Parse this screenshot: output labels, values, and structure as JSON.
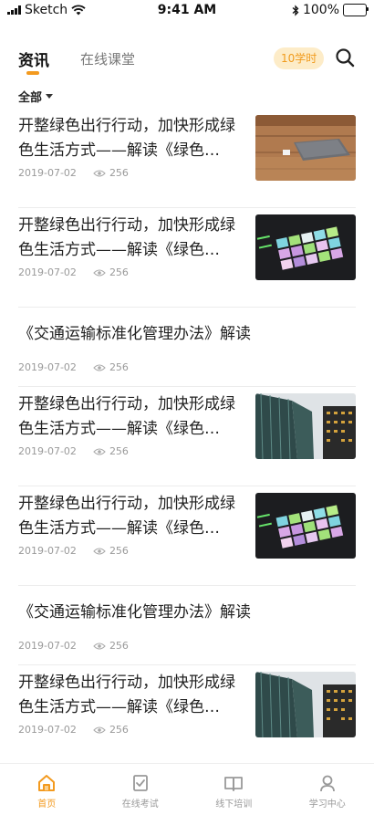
{
  "status_bar": {
    "carrier": "Sketch",
    "time": "9:41 AM",
    "battery_percent": "100%",
    "battery_level": 1.0
  },
  "top_nav": {
    "tabs": [
      {
        "label": "资讯",
        "active": true
      },
      {
        "label": "在线课堂",
        "active": false
      }
    ],
    "hours_badge": "10学时",
    "accent_color": "#f39a1f"
  },
  "filter": {
    "label": "全部"
  },
  "articles": [
    {
      "title": "开整绿色出行行动，加快形成绿色生活方式——解读《绿色…",
      "date": "2019-07-02",
      "views": "256",
      "image": "laptop-on-wooden-table"
    },
    {
      "title": "开整绿色出行行动，加快形成绿色生活方式——解读《绿色…",
      "date": "2019-07-02",
      "views": "256",
      "image": "launchpad-pads"
    },
    {
      "title": "《交通运输标准化管理办法》解读",
      "date": "2019-07-02",
      "views": "256",
      "image": null
    },
    {
      "title": "开整绿色出行行动，加快形成绿色生活方式——解读《绿色…",
      "date": "2019-07-02",
      "views": "256",
      "image": "skyscrapers"
    },
    {
      "title": "开整绿色出行行动，加快形成绿色生活方式——解读《绿色…",
      "date": "2019-07-02",
      "views": "256",
      "image": "launchpad-pads"
    },
    {
      "title": "《交通运输标准化管理办法》解读",
      "date": "2019-07-02",
      "views": "256",
      "image": null
    },
    {
      "title": "开整绿色出行行动，加快形成绿色生活方式——解读《绿色…",
      "date": "2019-07-02",
      "views": "256",
      "image": "skyscrapers"
    }
  ],
  "tabbar": {
    "items": [
      {
        "label": "首页",
        "icon": "home-icon",
        "active": true
      },
      {
        "label": "在线考试",
        "icon": "exam-icon",
        "active": false
      },
      {
        "label": "线下培训",
        "icon": "book-icon",
        "active": false
      },
      {
        "label": "学习中心",
        "icon": "user-icon",
        "active": false
      }
    ]
  }
}
